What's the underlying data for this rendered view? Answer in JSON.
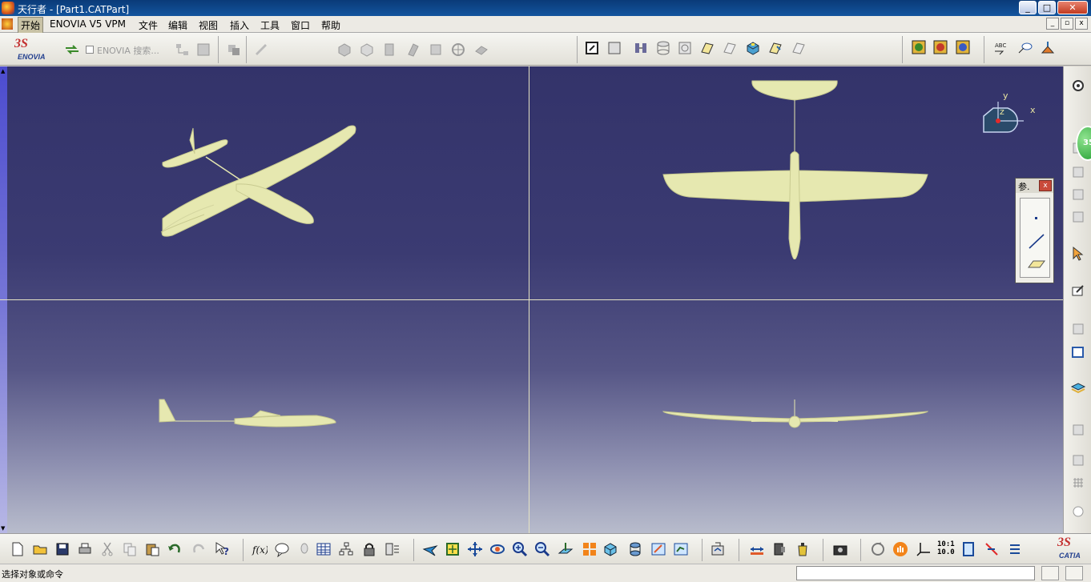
{
  "window": {
    "title": "天行者  - [Part1.CATPart]",
    "buttons": {
      "minimize": "_",
      "maximize": "□",
      "close": "✕"
    }
  },
  "menubar": {
    "items": [
      "开始",
      "ENOVIA V5 VPM",
      "文件",
      "编辑",
      "视图",
      "插入",
      "工具",
      "窗口",
      "帮助"
    ],
    "mdi_buttons": {
      "minimize": "_",
      "restore": "▫",
      "close": "x"
    }
  },
  "enovia": {
    "logo_top": "3S",
    "logo_text": "ENOVIA",
    "search_label": "ENOVIA 搜索..."
  },
  "viewport": {
    "axis": {
      "x": "x",
      "y": "y",
      "z": "z"
    }
  },
  "ref_panel": {
    "title": "参.",
    "close": "x"
  },
  "side_badge": "35",
  "bottom_toolbar": {
    "ratio_top": "10:1",
    "ratio_bottom": "10.0",
    "logo_top": "3S",
    "logo_text": "CATIA"
  },
  "statusbar": {
    "message": "选择对象或命令",
    "command_value": ""
  },
  "colors": {
    "titlebar": "#0a3a78",
    "viewport_top": "#33336a",
    "viewport_bottom": "#b8bccc",
    "model": "#e6e8b0",
    "divider": "#e6e4c4"
  }
}
